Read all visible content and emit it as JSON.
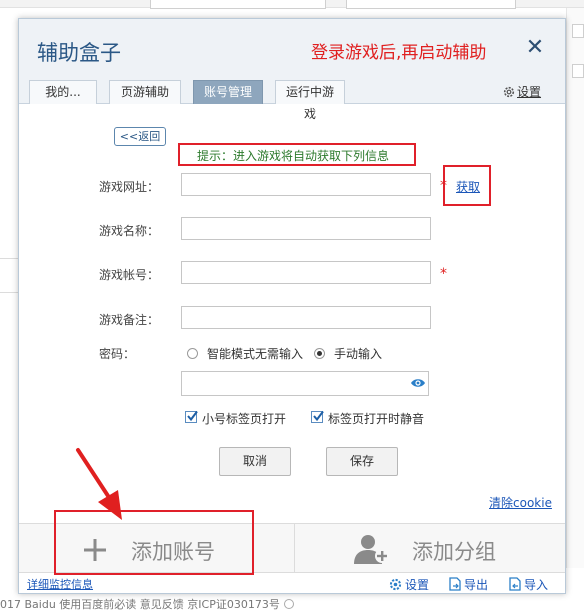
{
  "dialog": {
    "title": "辅助盒子",
    "annotation": "登录游戏后,再启动辅助"
  },
  "tabs": [
    {
      "label": "我的..."
    },
    {
      "label": "页游辅助"
    },
    {
      "label": "账号管理",
      "active": true
    },
    {
      "label": "运行中游戏"
    }
  ],
  "settings": {
    "label": "设置",
    "icon": "gear-icon"
  },
  "back_button": "<<返回",
  "hint": "提示：进入游戏将自动获取下列信息",
  "form": {
    "game_url_label": "游戏网址：",
    "game_url_value": "",
    "fetch_link": "获取",
    "game_name_label": "游戏名称：",
    "game_name_value": "",
    "account_label": "游戏帐号：",
    "account_value": "",
    "note_label": "游戏备注：",
    "note_value": "",
    "required_mark": "*",
    "password_label": "密码：",
    "mode_smart": "智能模式无需输入",
    "mode_manual": "手动输入",
    "mode_selected": "手动输入",
    "password_value": "",
    "checkbox_small_tab": "小号标签页打开",
    "checkbox_small_tab_checked": true,
    "checkbox_mute": "标签页打开时静音",
    "checkbox_mute_checked": true
  },
  "buttons": {
    "cancel": "取消",
    "save": "保存"
  },
  "clear_cookie": "清除cookie",
  "bottom": {
    "add_account": "添加账号",
    "add_group": "添加分组"
  },
  "status": {
    "detail_link": "详细监控信息",
    "settings": "设置",
    "export": "导出",
    "import": "导入"
  },
  "background": {
    "footer_text": "017 Baidu 使用百度前必读 意见反馈 京ICP证030173号"
  },
  "colors": {
    "accent": "#2b5886",
    "annotation_red": "#e02020",
    "active_tab": "#8ea6bd",
    "hint_green": "#2c7a2c",
    "link_blue": "#1b56b8"
  }
}
